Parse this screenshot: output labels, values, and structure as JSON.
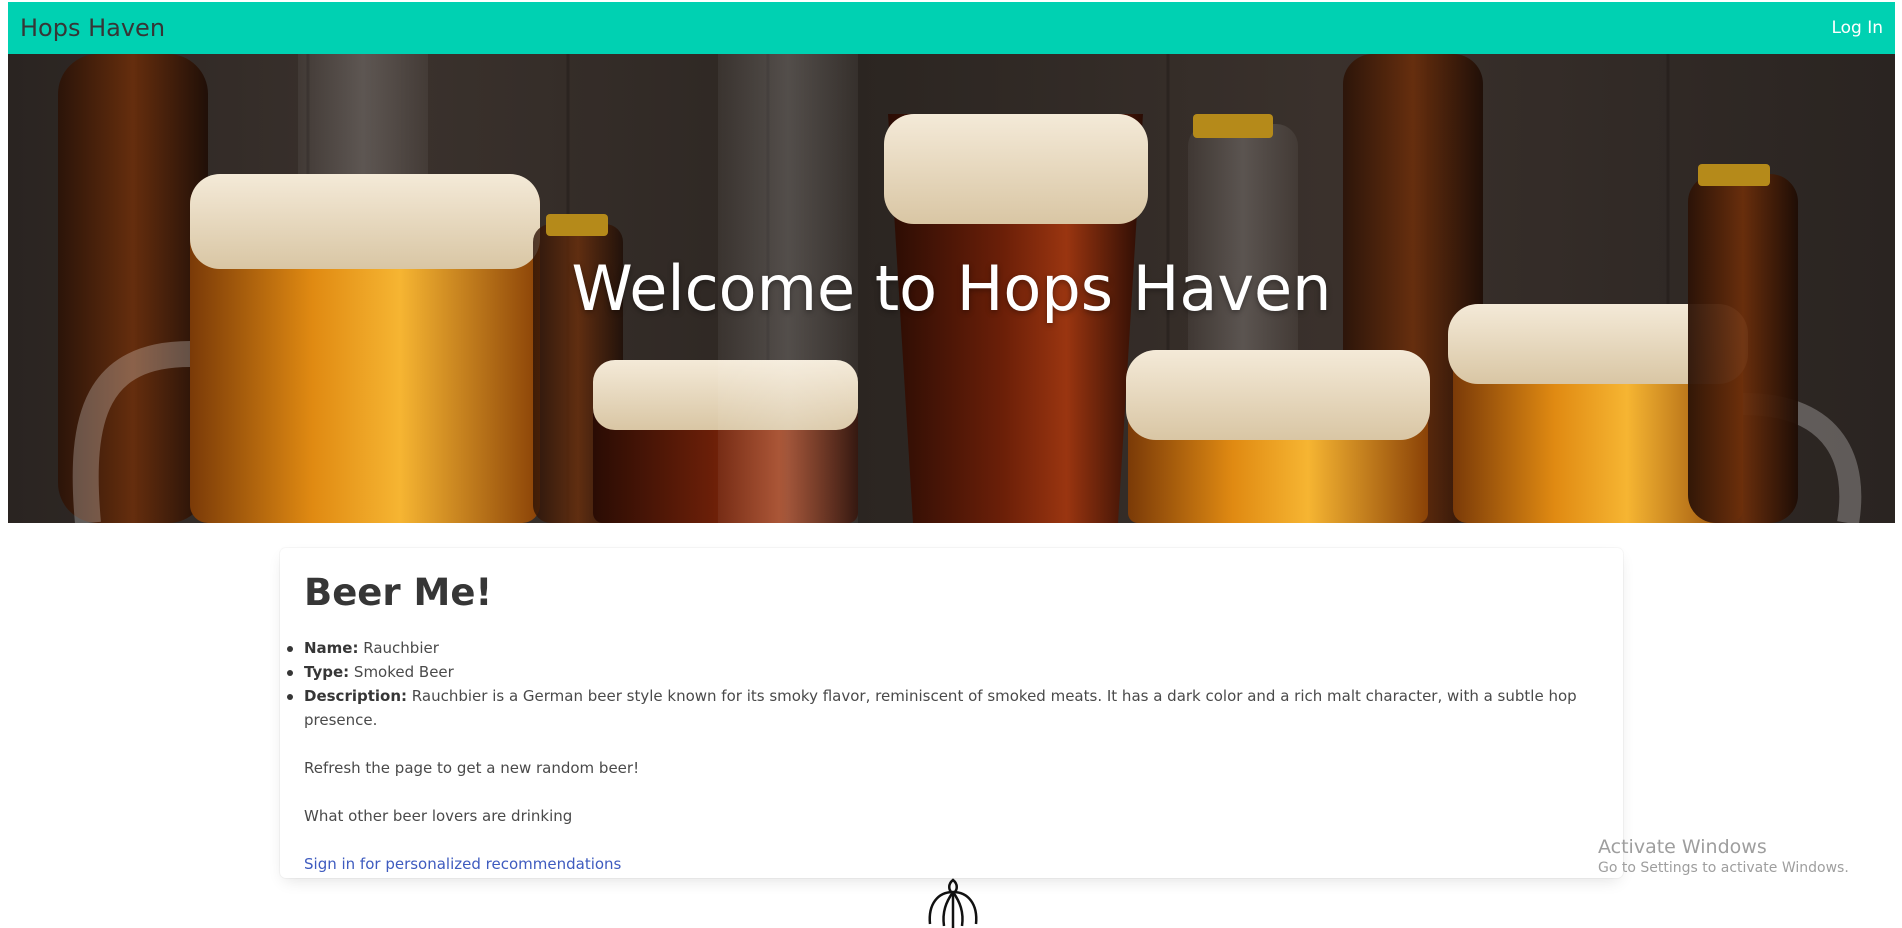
{
  "navbar": {
    "brand": "Hops Haven",
    "login_label": "Log In",
    "background_color": "#00d1b2"
  },
  "hero": {
    "title": "Welcome to Hops Haven"
  },
  "card": {
    "title": "Beer Me!",
    "details": [
      {
        "label": "Name:",
        "value": "Rauchbier"
      },
      {
        "label": "Type:",
        "value": "Smoked Beer"
      },
      {
        "label": "Description:",
        "value": "Rauchbier is a German beer style known for its smoky flavor, reminiscent of smoked meats. It has a dark color and a rich malt character, with a subtle hop presence."
      }
    ],
    "refresh_text": "Refresh the page to get a new random beer!",
    "others_text": "What other beer lovers are drinking",
    "signin_link": "Sign in for personalized recommendations",
    "link_color": "#3e5bbf"
  },
  "watermark": {
    "line1": "Activate Windows",
    "line2": "Go to Settings to activate Windows."
  },
  "icons": {
    "hop": "hop-icon"
  }
}
